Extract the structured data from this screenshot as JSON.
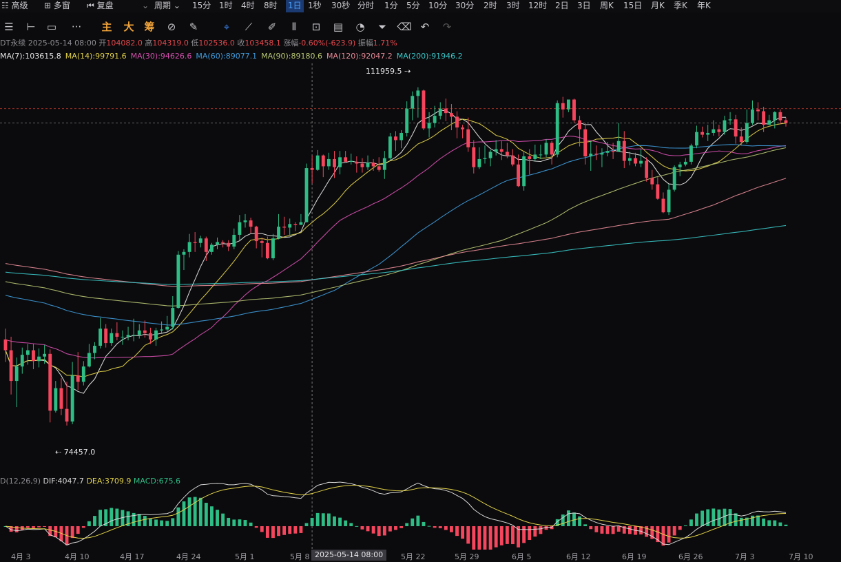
{
  "timeframes": {
    "leading": [
      {
        "icon": "grid-icon",
        "label": "高级"
      },
      {
        "icon": "windows-icon",
        "label": "多窗"
      },
      {
        "icon": "rewind-icon",
        "label": "复盘"
      }
    ],
    "period_label": "周期",
    "items": [
      "15分",
      "1时",
      "4时",
      "8时",
      "1日",
      "1秒",
      "30秒",
      "分时",
      "1分",
      "5分",
      "10分",
      "30分",
      "2时",
      "3时",
      "12时",
      "2日",
      "3日",
      "周K",
      "15日",
      "月K",
      "季K",
      "年K"
    ],
    "active": "1日"
  },
  "toolbar": {
    "main": "主",
    "big": "大",
    "chip": "筹"
  },
  "info": {
    "symbol": "DT永续",
    "date": "2025-05-14 08:00",
    "open_label": "开",
    "open": "104082.0",
    "high_label": "高",
    "high": "104319.0",
    "low_label": "低",
    "low": "102536.0",
    "close_label": "收",
    "close": "103458.1",
    "change_label": "涨幅",
    "change": "-0.60%(-623.9)",
    "amp_label": "振幅",
    "amp": "1.71%"
  },
  "mas": [
    {
      "label": "MA(7):103615.8",
      "color": "#e6e6e6"
    },
    {
      "label": "MA(14):99791.6",
      "color": "#e3d34a"
    },
    {
      "label": "MA(30):94626.6",
      "color": "#d64fb0"
    },
    {
      "label": "MA(60):89077.1",
      "color": "#3f9bdc"
    },
    {
      "label": "MA(90):89180.6",
      "color": "#b8c774"
    },
    {
      "label": "MA(120):92047.2",
      "color": "#e48a96"
    },
    {
      "label": "MA(200):91946.2",
      "color": "#3ac6c8"
    }
  ],
  "macd": {
    "label": "D(12,26,9)",
    "dif": "DIF:4047.7",
    "dea": "DEA:3709.9",
    "macd": "MACD:675.6"
  },
  "extremes": {
    "high": "111959.5",
    "low": "74457.0"
  },
  "dates": [
    "4月 3",
    "4月 10",
    "4月 17",
    "4月 24",
    "5月 1",
    "5月 8",
    "5月 22",
    "5月 29",
    "6月 5",
    "6月 12",
    "6月 19",
    "6月 26",
    "7月 3",
    "7月 10"
  ],
  "cursor_date": "2025-05-14 08:00",
  "colors": {
    "up": "#2ebd85",
    "down": "#f6465d",
    "ma7": "#e6e6e6",
    "ma14": "#e3d34a",
    "ma30": "#d64fb0",
    "ma60": "#3f9bdc",
    "ma90": "#b8c774",
    "ma120": "#e48a96",
    "ma200": "#3ac6c8",
    "dif": "#d8d8d8",
    "dea": "#e3d34a"
  },
  "chart_data": {
    "type": "candlestick",
    "ylim": [
      72000,
      114000
    ],
    "candles": [
      [
        84000,
        82800,
        85200,
        81500
      ],
      [
        82800,
        79400,
        84300,
        77900
      ],
      [
        79400,
        81000,
        82000,
        76500
      ],
      [
        81000,
        82300,
        83100,
        80200
      ],
      [
        82300,
        82800,
        83500,
        81200
      ],
      [
        82800,
        81600,
        83500,
        80700
      ],
      [
        81600,
        82100,
        83000,
        80900
      ],
      [
        82100,
        82400,
        83400,
        81300
      ],
      [
        82400,
        76100,
        82900,
        74800
      ],
      [
        76100,
        78600,
        79400,
        75900
      ],
      [
        78600,
        76300,
        79700,
        75600
      ],
      [
        76300,
        74900,
        79300,
        74457
      ],
      [
        74900,
        80000,
        81500,
        74600
      ],
      [
        80000,
        79300,
        82600,
        78400
      ],
      [
        79300,
        81000,
        81600,
        78900
      ],
      [
        81000,
        82500,
        83500,
        80900
      ],
      [
        82500,
        83300,
        83700,
        81800
      ],
      [
        83300,
        85200,
        86400,
        83000
      ],
      [
        85200,
        83600,
        85700,
        83100
      ],
      [
        83600,
        84700,
        85200,
        83300
      ],
      [
        84700,
        84300,
        85900,
        83900
      ],
      [
        84300,
        84300,
        85000,
        83400
      ],
      [
        84300,
        84500,
        85400,
        83900
      ],
      [
        84500,
        84500,
        86300,
        83800
      ],
      [
        84500,
        85000,
        85700,
        84100
      ],
      [
        85000,
        84700,
        86100,
        84200
      ],
      [
        84700,
        84000,
        85300,
        83500
      ],
      [
        84000,
        85000,
        85300,
        83300
      ],
      [
        85000,
        85100,
        86000,
        84600
      ],
      [
        85100,
        85400,
        86600,
        84900
      ],
      [
        85400,
        87500,
        88800,
        85100
      ],
      [
        87500,
        93400,
        93800,
        87400
      ],
      [
        93400,
        93700,
        94000,
        91700
      ],
      [
        93700,
        94800,
        95700,
        93100
      ],
      [
        94800,
        94700,
        95900,
        93700
      ],
      [
        94700,
        95200,
        95500,
        94200
      ],
      [
        95200,
        93700,
        95400,
        92700
      ],
      [
        93700,
        94500,
        94700,
        93400
      ],
      [
        94500,
        94800,
        95300,
        94000
      ],
      [
        94800,
        94700,
        95000,
        94200
      ],
      [
        94700,
        94300,
        95000,
        93800
      ],
      [
        94300,
        95600,
        96300,
        94000
      ],
      [
        95600,
        97000,
        97800,
        95000
      ],
      [
        97000,
        97200,
        97900,
        96400
      ],
      [
        97200,
        96500,
        97500,
        95800
      ],
      [
        96500,
        94900,
        96600,
        94100
      ],
      [
        94900,
        94700,
        95300,
        93100
      ],
      [
        94700,
        93000,
        95400,
        92900
      ],
      [
        93000,
        95200,
        95700,
        92800
      ],
      [
        95200,
        96500,
        97900,
        95100
      ],
      [
        96500,
        96400,
        97600,
        95600
      ],
      [
        96400,
        96800,
        97400,
        95500
      ],
      [
        96800,
        96700,
        97000,
        96000
      ],
      [
        96700,
        97000,
        97900,
        96700
      ],
      [
        97000,
        103000,
        103500,
        97000
      ],
      [
        103000,
        102800,
        104400,
        101300
      ],
      [
        102800,
        104400,
        105000,
        102700
      ],
      [
        104400,
        103200,
        104500,
        102000
      ],
      [
        103200,
        104000,
        104700,
        102800
      ],
      [
        104000,
        103100,
        104900,
        101900
      ],
      [
        103100,
        104200,
        104900,
        102300
      ],
      [
        104200,
        103700,
        104900,
        103600
      ],
      [
        103700,
        103800,
        104600,
        103400
      ],
      [
        103700,
        103500,
        104300,
        102500
      ],
      [
        103500,
        103100,
        104100,
        102500
      ],
      [
        103100,
        103600,
        104400,
        102800
      ],
      [
        103600,
        103200,
        104000,
        102700
      ],
      [
        103200,
        102800,
        104200,
        102600
      ],
      [
        102800,
        104100,
        104900,
        101800
      ],
      [
        104100,
        106500,
        106900,
        103900
      ],
      [
        106500,
        106100,
        107100,
        104900
      ],
      [
        106100,
        106900,
        107200,
        105200
      ],
      [
        106900,
        109600,
        110400,
        106500
      ],
      [
        109600,
        111000,
        111500,
        108300
      ],
      [
        111000,
        111600,
        111959.5,
        108600
      ],
      [
        111600,
        107400,
        111700,
        107200
      ],
      [
        107400,
        108000,
        109200,
        106400
      ],
      [
        108000,
        108800,
        109900,
        107500
      ],
      [
        108800,
        109600,
        110300,
        108400
      ],
      [
        109600,
        109100,
        110700,
        108200
      ],
      [
        109100,
        108700,
        110100,
        107200
      ],
      [
        108700,
        107500,
        109300,
        106300
      ],
      [
        107500,
        107300,
        107800,
        106300
      ],
      [
        107300,
        105300,
        108600,
        104800
      ],
      [
        105300,
        103100,
        106100,
        102400
      ],
      [
        103100,
        104000,
        105300,
        102900
      ],
      [
        104000,
        104100,
        105500,
        103500
      ],
      [
        104100,
        104800,
        105000,
        103200
      ],
      [
        104800,
        105100,
        106100,
        104400
      ],
      [
        105100,
        104800,
        106000,
        103900
      ],
      [
        104800,
        104400,
        105800,
        104100
      ],
      [
        104400,
        103400,
        105100,
        103200
      ],
      [
        103400,
        101000,
        104500,
        100900
      ],
      [
        101000,
        104300,
        104800,
        100500
      ],
      [
        104300,
        104000,
        105100,
        102300
      ],
      [
        104000,
        104500,
        105600,
        103800
      ],
      [
        104500,
        104500,
        105600,
        104000
      ],
      [
        104500,
        105800,
        106200,
        104200
      ],
      [
        105800,
        104500,
        106000,
        103400
      ],
      [
        104500,
        110200,
        110500,
        104200
      ],
      [
        110200,
        109500,
        110900,
        108600
      ],
      [
        109500,
        110600,
        110500,
        109200
      ],
      [
        110600,
        108300,
        110700,
        108000
      ],
      [
        108300,
        107300,
        108800,
        105400
      ],
      [
        107300,
        104300,
        108000,
        103400
      ],
      [
        104300,
        104600,
        106000,
        102700
      ],
      [
        104600,
        104500,
        105500,
        103900
      ],
      [
        104500,
        104700,
        105200,
        103100
      ],
      [
        104700,
        104900,
        105900,
        104300
      ],
      [
        104900,
        104800,
        105800,
        104000
      ],
      [
        104800,
        106000,
        108000,
        104800
      ],
      [
        106000,
        103800,
        107100,
        103000
      ],
      [
        103800,
        104100,
        104800,
        103300
      ],
      [
        104100,
        103500,
        104700,
        103200
      ],
      [
        103500,
        103800,
        105100,
        103100
      ],
      [
        103800,
        101900,
        104200,
        101500
      ],
      [
        101900,
        101200,
        102800,
        100600
      ],
      [
        101200,
        99600,
        102000,
        99500
      ],
      [
        99600,
        98100,
        100300,
        98000
      ],
      [
        98100,
        100600,
        101200,
        97800
      ],
      [
        100600,
        103100,
        103300,
        100400
      ],
      [
        103100,
        103400,
        103700,
        102100
      ],
      [
        103400,
        103700,
        104100,
        103200
      ],
      [
        103700,
        105500,
        105700,
        103400
      ],
      [
        105500,
        107000,
        107700,
        105200
      ],
      [
        107000,
        106700,
        107600,
        106400
      ],
      [
        106700,
        106900,
        107800,
        106000
      ],
      [
        106900,
        107300,
        108300,
        106600
      ],
      [
        107300,
        107000,
        107800,
        106500
      ],
      [
        107000,
        108300,
        108800,
        106700
      ],
      [
        108300,
        108400,
        109200,
        107800
      ],
      [
        108400,
        106500,
        108900,
        105700
      ],
      [
        106500,
        105900,
        107500,
        105500
      ],
      [
        105900,
        108000,
        109500,
        105700
      ],
      [
        108000,
        109500,
        110500,
        107800
      ],
      [
        109500,
        109300,
        110300,
        108300
      ],
      [
        109300,
        107800,
        109800,
        107000
      ],
      [
        107800,
        108300,
        108900,
        107800
      ],
      [
        108300,
        109200,
        109300,
        107400
      ],
      [
        109200,
        108300,
        109500,
        107900
      ],
      [
        108300,
        108000,
        108600,
        107600
      ]
    ],
    "cursor_index": 55
  }
}
